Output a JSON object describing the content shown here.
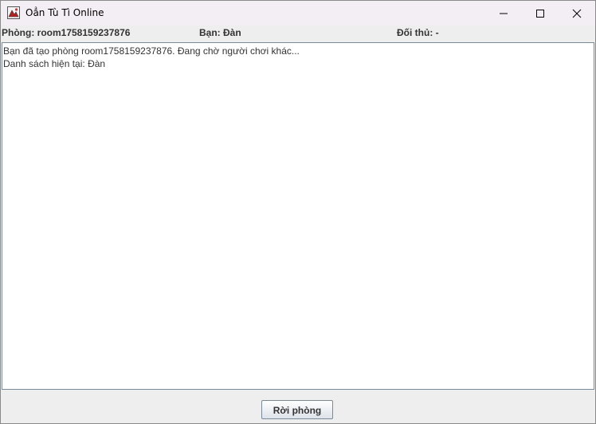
{
  "window": {
    "title": "Oẳn Tù Tì Online"
  },
  "info": {
    "room": "Phòng: room1758159237876",
    "you": "Bạn: Đàn",
    "opponent": "Đối thủ: -"
  },
  "log": {
    "lines": [
      "Bạn đã tạo phòng room1758159237876. Đang chờ người chơi khác...",
      "Danh sách hiện tại: Đàn"
    ]
  },
  "actions": {
    "leave_label": "Rời phòng"
  },
  "icons": {
    "app": "java-app-icon",
    "minimize": "minimize-icon",
    "maximize": "maximize-icon",
    "close": "close-icon"
  }
}
